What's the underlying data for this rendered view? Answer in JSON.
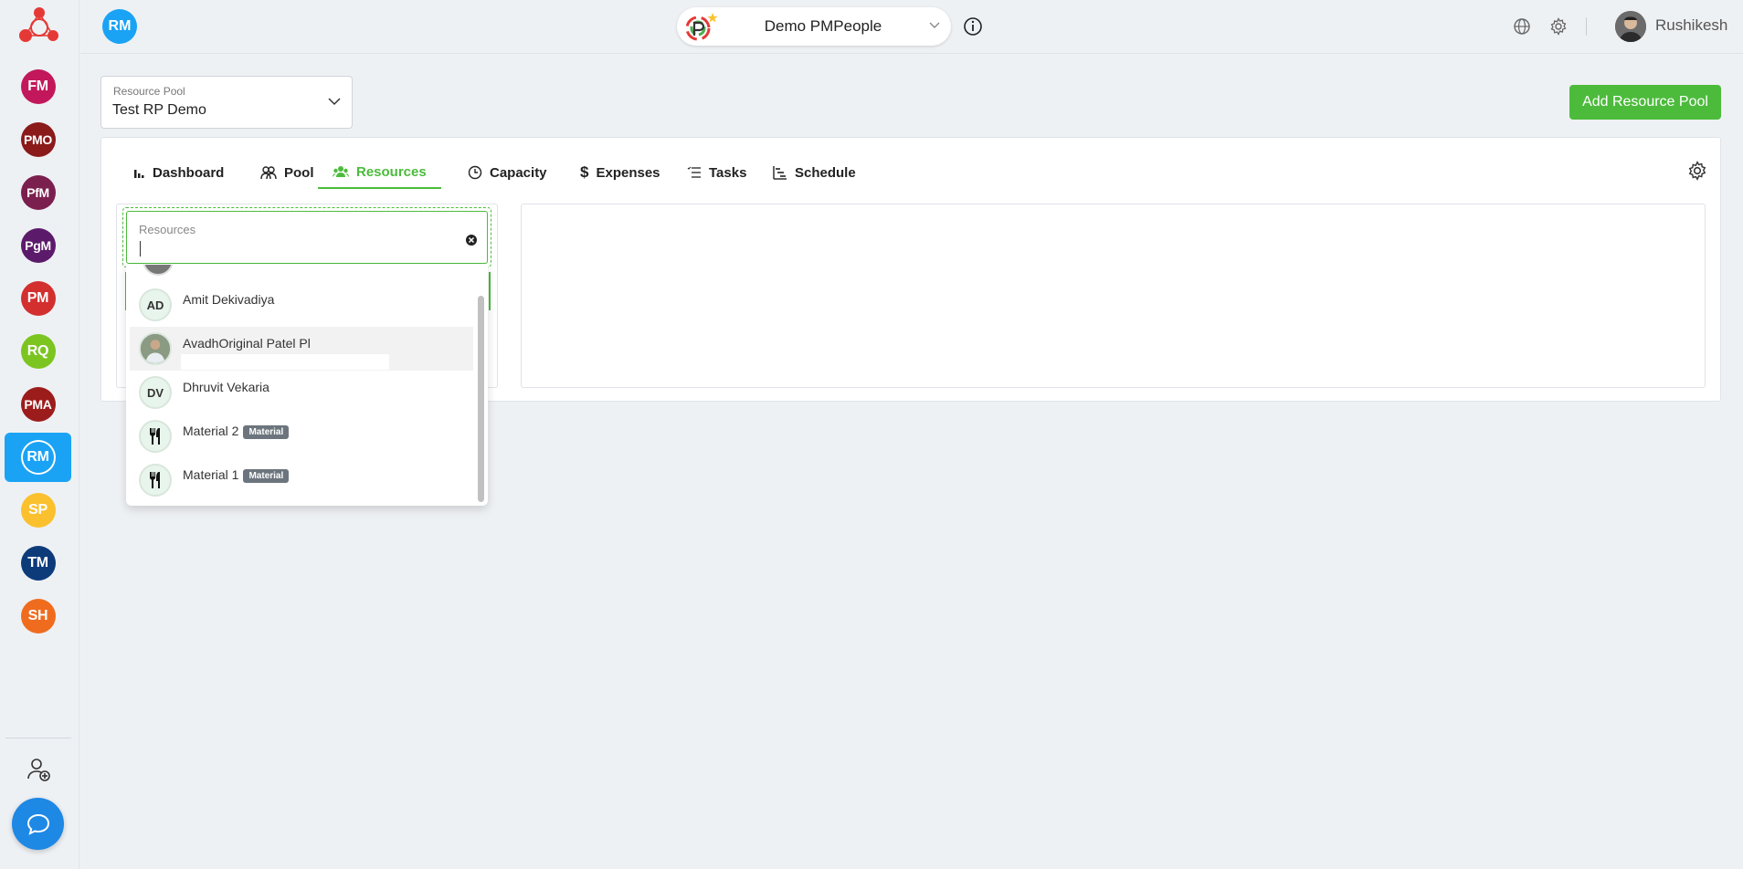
{
  "sidebar": {
    "items": [
      {
        "label": "FM",
        "color": "#c2185b"
      },
      {
        "label": "PMO",
        "color": "#8b1a1a"
      },
      {
        "label": "PfM",
        "color": "#7b1f4e"
      },
      {
        "label": "PgM",
        "color": "#5c1a6b"
      },
      {
        "label": "PM",
        "color": "#d32f2f"
      },
      {
        "label": "RQ",
        "color": "#7cc520"
      },
      {
        "label": "PMA",
        "color": "#9c1c1c"
      },
      {
        "label": "RM",
        "color": "#1aa3f5"
      },
      {
        "label": "SP",
        "color": "#fbc02d"
      },
      {
        "label": "TM",
        "color": "#0d3b7a"
      },
      {
        "label": "SH",
        "color": "#ef6c1f"
      }
    ],
    "active": "RM",
    "add_user_icon": "user-plus-icon",
    "chat_icon": "chat-bubble-icon"
  },
  "header": {
    "module_badge": "RM",
    "workspace_name": "Demo PMPeople",
    "user_name": "Rushikesh"
  },
  "resource_pool": {
    "label": "Resource Pool",
    "value": "Test RP Demo"
  },
  "add_pool_button": "Add Resource Pool",
  "tabs": [
    {
      "label": "Dashboard",
      "icon": "bar-chart-icon"
    },
    {
      "label": "Pool",
      "icon": "people-icon"
    },
    {
      "label": "Resources",
      "icon": "group-icon",
      "active": true
    },
    {
      "label": "Capacity",
      "icon": "clock-icon"
    },
    {
      "label": "Expenses",
      "icon": "dollar-icon"
    },
    {
      "label": "Tasks",
      "icon": "list-icon"
    },
    {
      "label": "Schedule",
      "icon": "gantt-icon"
    }
  ],
  "search": {
    "label": "Resources",
    "value": ""
  },
  "options": [
    {
      "initials": "AD",
      "name": "Amit Dekivadiya",
      "tag": ""
    },
    {
      "initials": "",
      "name": "AvadhOriginal Patel Pl",
      "tag": "",
      "photo": true
    },
    {
      "initials": "DV",
      "name": "Dhruvit Vekaria",
      "tag": ""
    },
    {
      "initials": "",
      "name": "Material 2",
      "tag": "Material",
      "icon": "cutlery-icon"
    },
    {
      "initials": "",
      "name": "Material 1",
      "tag": "Material",
      "icon": "cutlery-icon"
    }
  ],
  "colors": {
    "accent_green": "#4cbb3c",
    "accent_blue": "#1aa3f5"
  }
}
